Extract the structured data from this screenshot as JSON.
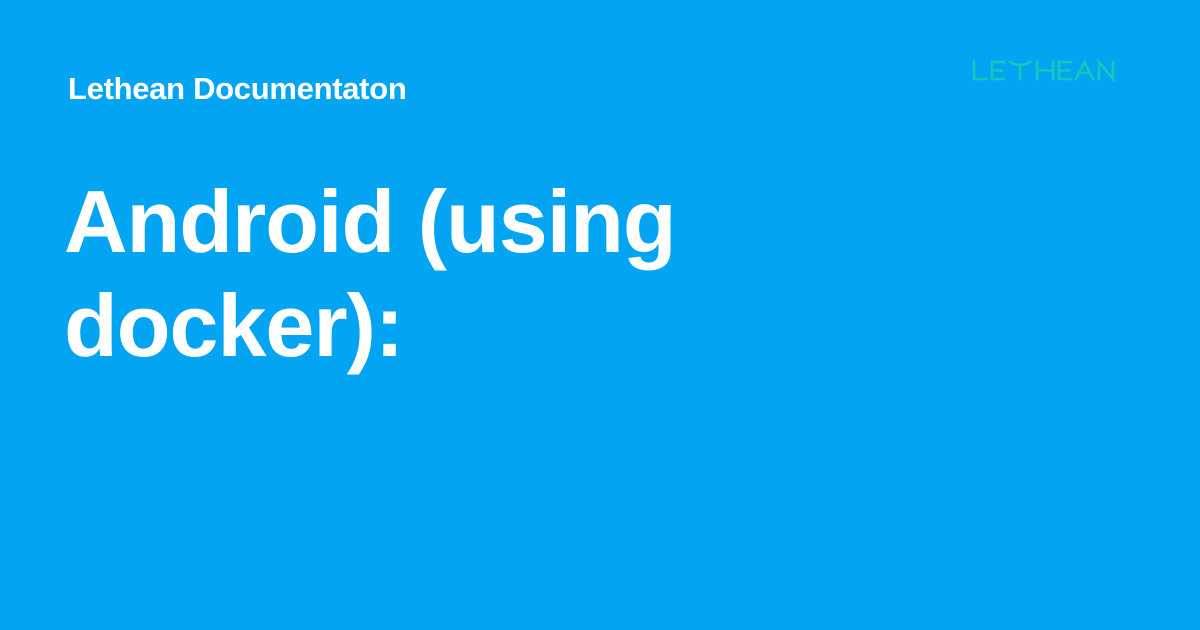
{
  "site": {
    "name": "Lethean Documentaton"
  },
  "logo": {
    "text": "LETHEAN",
    "color": "#15c7b9"
  },
  "page": {
    "title": "Android (using docker):"
  },
  "colors": {
    "background": "#03a5f3",
    "text": "#ffffff",
    "logo": "#15c7b9"
  }
}
